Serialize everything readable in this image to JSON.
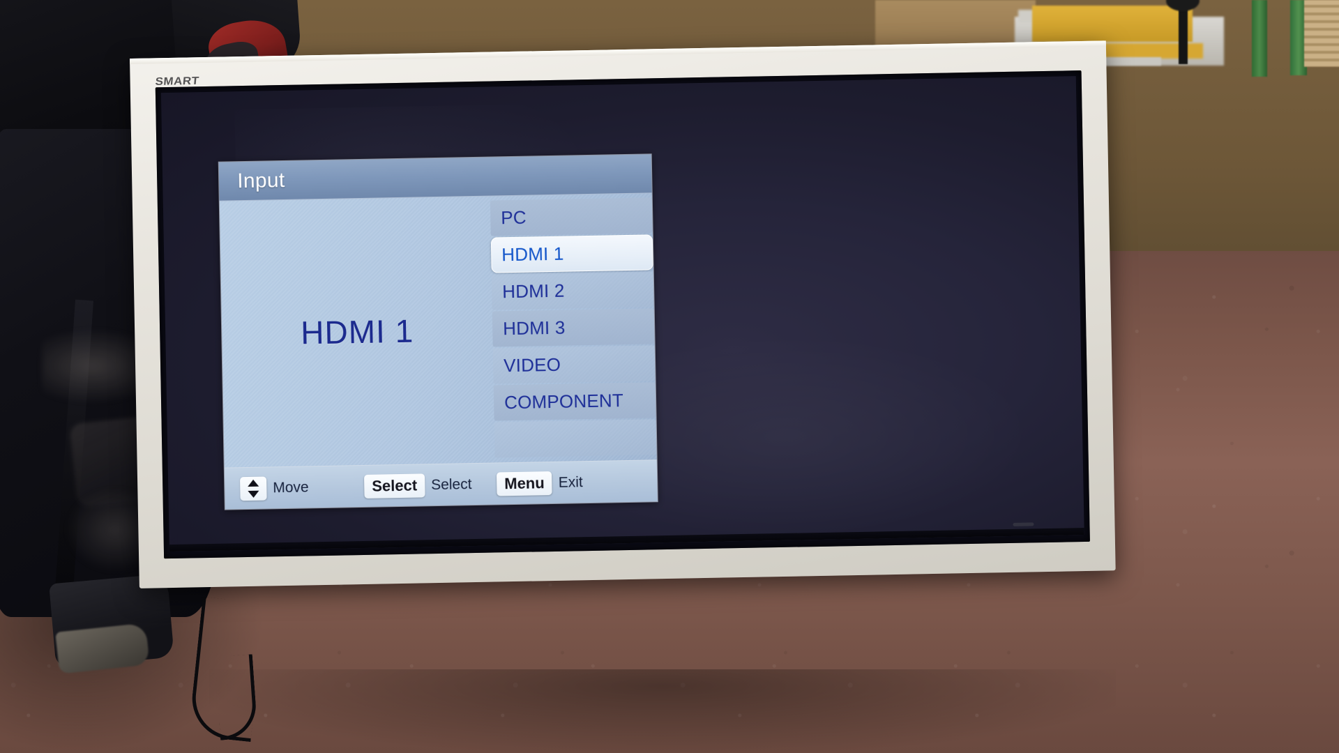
{
  "device": {
    "brand_logo": "SMART",
    "type": "interactive-flat-panel-display"
  },
  "osd": {
    "title": "Input",
    "preview_label": "HDMI 1",
    "selected_input": "HDMI 1",
    "items": [
      {
        "label": "PC",
        "selected": false
      },
      {
        "label": "HDMI 1",
        "selected": true
      },
      {
        "label": "HDMI 2",
        "selected": false
      },
      {
        "label": "HDMI 3",
        "selected": false
      },
      {
        "label": "VIDEO",
        "selected": false
      },
      {
        "label": "COMPONENT",
        "selected": false
      },
      {
        "label": "",
        "selected": false
      }
    ],
    "footer_hints": [
      {
        "key": "⬍",
        "key_icon": "up-down-arrow-icon",
        "label": "Move"
      },
      {
        "key": "Select",
        "key_icon": "select-key",
        "label": "Select"
      },
      {
        "key": "Menu",
        "key_icon": "menu-key",
        "label": "Exit"
      }
    ],
    "colors": {
      "title_bar": "#7f98ba",
      "body": "#b1c7e0",
      "item_text": "#1e2f96",
      "selected_text": "#1556c8",
      "selected_bg": "#e7eff8",
      "footer_bar": "#b4c7dd",
      "preview_text": "#1b2a8c",
      "title_text": "#ffffff"
    }
  },
  "scene": {
    "background_description": "workshop interior",
    "floor_color": "#7d584c",
    "wall_color": "#6d5738",
    "bezel_color": "#e8e5de",
    "screen_color": "#25243a",
    "glove_color": "#9d2a26",
    "clothing_color": "#101016"
  }
}
